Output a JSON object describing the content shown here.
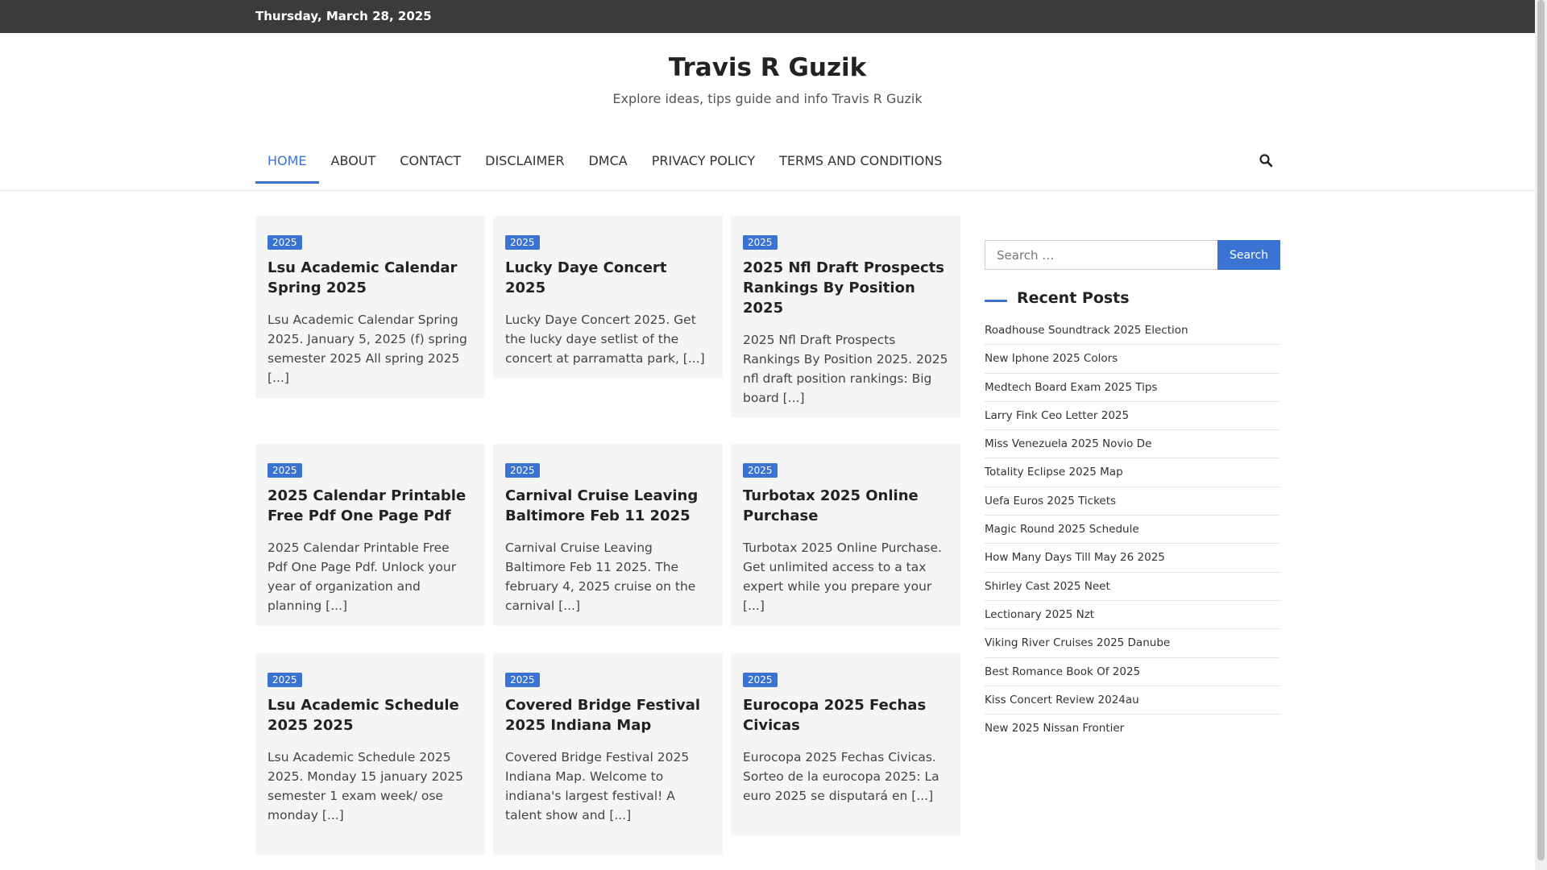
{
  "topbar": {
    "date": "Thursday, March 28, 2025"
  },
  "header": {
    "title": "Travis R Guzik",
    "description": "Explore ideas, tips guide and info Travis R Guzik"
  },
  "nav": {
    "items": [
      {
        "label": "HOME",
        "active": true
      },
      {
        "label": "ABOUT"
      },
      {
        "label": "CONTACT"
      },
      {
        "label": "DISCLAIMER"
      },
      {
        "label": "DMCA"
      },
      {
        "label": "PRIVACY POLICY"
      },
      {
        "label": "TERMS AND CONDITIONS"
      }
    ],
    "search_icon": "search-icon"
  },
  "posts": [
    {
      "tag": "2025",
      "title": "Lsu Academic Calendar Spring 2025",
      "excerpt": "Lsu Academic Calendar Spring 2025. January 5, 2025 (f) spring semester 2025 All spring 2025 [...]"
    },
    {
      "tag": "2025",
      "title": "Lucky Daye Concert 2025",
      "excerpt": "Lucky Daye Concert 2025. Get the lucky daye setlist of the concert at parramatta park, [...]"
    },
    {
      "tag": "2025",
      "title": "2025 Nfl Draft Prospects Rankings By Position 2025",
      "excerpt": "2025 Nfl Draft Prospects Rankings By Position 2025. 2025 nfl draft position rankings: Big board [...]"
    },
    {
      "tag": "2025",
      "title": "2025 Calendar Printable Free Pdf One Page Pdf",
      "excerpt": "2025 Calendar Printable Free Pdf One Page Pdf. Unlock your year of organization and planning [...]"
    },
    {
      "tag": "2025",
      "title": "Carnival Cruise Leaving Baltimore Feb 11 2025",
      "excerpt": "Carnival Cruise Leaving Baltimore Feb 11 2025. The february 4, 2025 cruise on the carnival [...]"
    },
    {
      "tag": "2025",
      "title": "Turbotax 2025 Online Purchase",
      "excerpt": "Turbotax 2025 Online Purchase. Get unlimited access to a tax expert while you prepare your [...]"
    },
    {
      "tag": "2025",
      "title": "Lsu Academic Schedule 2025 2025",
      "excerpt": "Lsu Academic Schedule 2025 2025. Monday 15 january 2025 semester 1 exam week/ ose monday [...]"
    },
    {
      "tag": "2025",
      "title": "Covered Bridge Festival 2025 Indiana Map",
      "excerpt": "Covered Bridge Festival 2025 Indiana Map. Welcome to indiana's largest festival! A talent show and [...]"
    },
    {
      "tag": "2025",
      "title": "Eurocopa 2025 Fechas Civicas",
      "excerpt": "Eurocopa 2025 Fechas Civicas. Sorteo de la eurocopa 2025: La euro 2025 se disputará en [...]"
    }
  ],
  "sidebar": {
    "search": {
      "placeholder": "Search …",
      "button": "Search"
    },
    "recent_posts_title": "Recent Posts",
    "recent_posts": [
      "Roadhouse Soundtrack 2025 Election",
      "New Iphone 2025 Colors",
      "Medtech Board Exam 2025 Tips",
      "Larry Fink Ceo Letter 2025",
      "Miss Venezuela 2025 Novio De",
      "Totality Eclipse 2025 Map",
      "Uefa Euros 2025 Tickets",
      "Magic Round 2025 Schedule",
      "How Many Days Till May 26 2025",
      "Shirley Cast 2025 Neet",
      "Lectionary 2025 Nzt",
      "Viking River Cruises 2025 Danube",
      "Best Romance Book Of 2025",
      "Kiss Concert Review 2024au",
      "New 2025 Nissan Frontier"
    ]
  },
  "colors": {
    "accent": "#3a73d1",
    "topbar": "#3b3b3b",
    "card_bg": "#f5f5f5"
  }
}
